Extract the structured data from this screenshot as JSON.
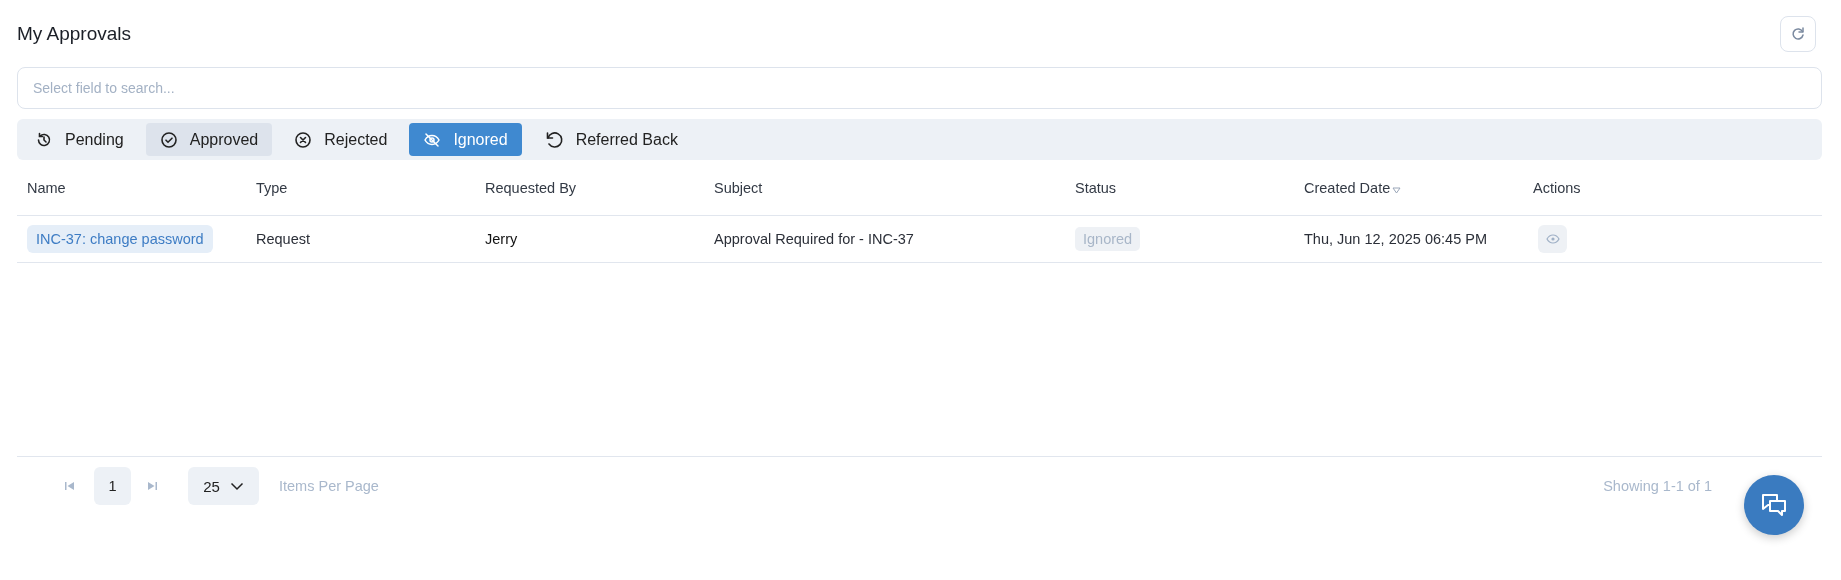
{
  "title": "My Approvals",
  "search": {
    "placeholder": "Select field to search..."
  },
  "tabs": [
    {
      "label": "Pending",
      "kind": "history",
      "selected": false,
      "highlighted": false
    },
    {
      "label": "Approved",
      "kind": "check",
      "selected": false,
      "highlighted": true
    },
    {
      "label": "Rejected",
      "kind": "cross",
      "selected": false,
      "highlighted": false
    },
    {
      "label": "Ignored",
      "kind": "eye-off",
      "selected": true,
      "highlighted": false
    },
    {
      "label": "Referred Back",
      "kind": "undo",
      "selected": false,
      "highlighted": false
    }
  ],
  "table": {
    "columns": [
      {
        "label": "Name",
        "sorted": false
      },
      {
        "label": "Type",
        "sorted": false
      },
      {
        "label": "Requested By",
        "sorted": false
      },
      {
        "label": "Subject",
        "sorted": false
      },
      {
        "label": "Status",
        "sorted": false
      },
      {
        "label": "Created Date",
        "sorted": true
      },
      {
        "label": "Actions",
        "sorted": false
      }
    ],
    "rows": [
      {
        "name": "INC-37: change password",
        "type": "Request",
        "requested_by": "Jerry",
        "subject": "Approval Required for - INC-37",
        "status": "Ignored",
        "created": "Thu, Jun 12, 2025 06:45 PM"
      }
    ]
  },
  "pagination": {
    "page": "1",
    "per_page": "25",
    "per_page_label": "Items Per Page",
    "summary": "Showing 1-1 of 1"
  }
}
